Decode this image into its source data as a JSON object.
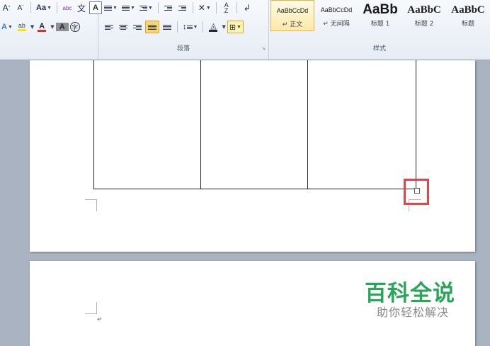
{
  "ribbon": {
    "font_group": {
      "row1": [
        "A",
        "A",
        "Aa",
        "abc",
        "文",
        "A"
      ],
      "row2": [
        "A",
        "ab",
        "A",
        "A",
        "字"
      ]
    },
    "paragraph_group": {
      "label": "段落"
    },
    "styles_group": {
      "label": "样式",
      "items": [
        {
          "sample": "AaBbCcDd",
          "name": "↵ 正文",
          "selected": true
        },
        {
          "sample": "AaBbCcDd",
          "name": "↵ 无间隔",
          "selected": false
        },
        {
          "sample": "AaBb",
          "name": "标题 1",
          "selected": false
        },
        {
          "sample": "AaBbC",
          "name": "标题 2",
          "selected": false
        },
        {
          "sample": "AaBbC",
          "name": "标题",
          "selected": false
        }
      ]
    }
  },
  "document": {
    "paragraph_mark": "↵"
  },
  "watermark": {
    "title": "百科全说",
    "subtitle": "助你轻松解决"
  },
  "colors": {
    "highlight": "#e0474c",
    "watermark_green": "#2aa55a",
    "font_color_red": "#e03030",
    "highlight_yellow": "#ffe600"
  }
}
